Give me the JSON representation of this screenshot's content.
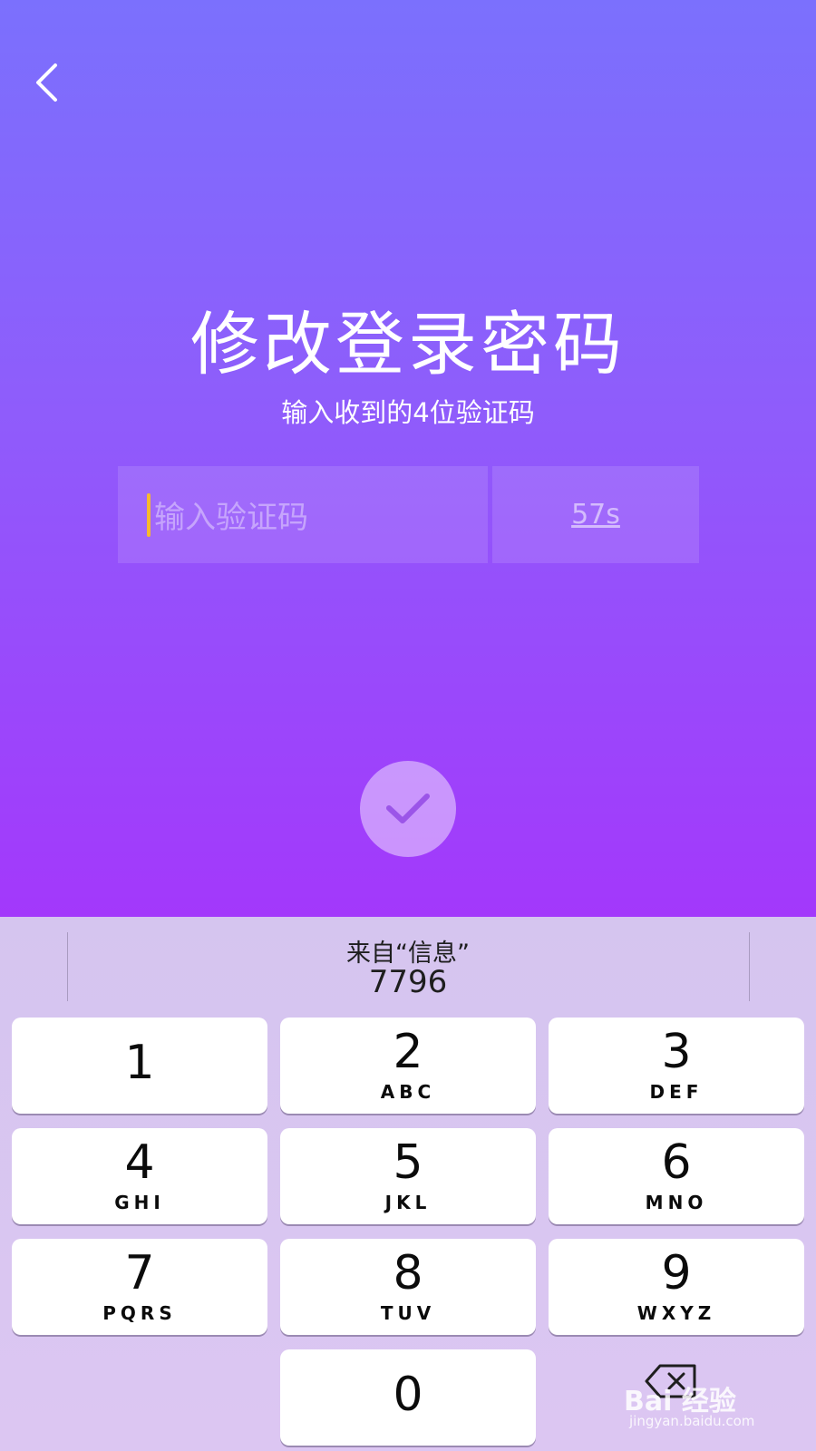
{
  "header": {
    "back_icon": "chevron-left-icon"
  },
  "main": {
    "title": "修改登录密码",
    "subtitle": "输入收到的4位验证码",
    "code_input": {
      "value": "",
      "placeholder": "输入验证码"
    },
    "countdown": "57s",
    "confirm_icon": "checkmark-icon"
  },
  "keyboard": {
    "suggestion": {
      "source": "来自“信息”",
      "code": "7796"
    },
    "keys": [
      {
        "num": "1",
        "letters": ""
      },
      {
        "num": "2",
        "letters": "ABC"
      },
      {
        "num": "3",
        "letters": "DEF"
      },
      {
        "num": "4",
        "letters": "GHI"
      },
      {
        "num": "5",
        "letters": "JKL"
      },
      {
        "num": "6",
        "letters": "MNO"
      },
      {
        "num": "7",
        "letters": "PQRS"
      },
      {
        "num": "8",
        "letters": "TUV"
      },
      {
        "num": "9",
        "letters": "WXYZ"
      },
      {
        "num": "0",
        "letters": ""
      }
    ],
    "delete_icon": "backspace-icon"
  },
  "watermark": {
    "brand": "Bai 经验",
    "url": "jingyan.baidu.com"
  },
  "colors": {
    "gradient_top": "#7b70fd",
    "gradient_bottom": "#a338fb",
    "cursor": "#f7b92e",
    "keyboard_bg": "#d9c6ef"
  }
}
